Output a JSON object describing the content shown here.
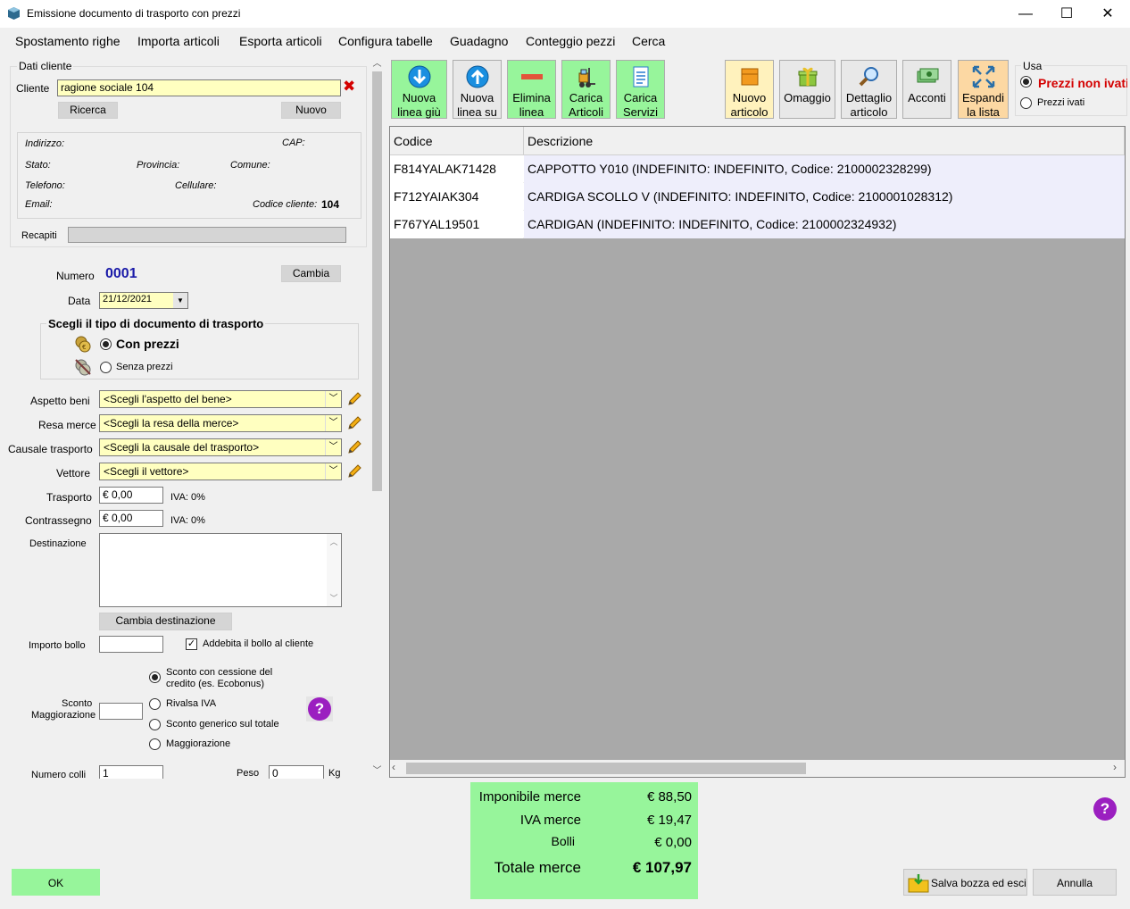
{
  "window": {
    "title": "Emissione documento di trasporto con prezzi",
    "minimize": "—",
    "maximize": "☐",
    "close": "✕"
  },
  "menu": [
    "Spostamento righe",
    "Importa articoli",
    "Esporta articoli",
    "Configura tabelle",
    "Guadagno",
    "Conteggio pezzi",
    "Cerca"
  ],
  "cliente": {
    "group_title": "Dati cliente",
    "label": "Cliente",
    "value": "ragione sociale 104",
    "ricerca": "Ricerca",
    "nuovo": "Nuovo",
    "indirizzo": "Indirizzo:",
    "cap": "CAP:",
    "stato": "Stato:",
    "provincia": "Provincia:",
    "comune": "Comune:",
    "telefono": "Telefono:",
    "cellulare": "Cellulare:",
    "email": "Email:",
    "codice_label": "Codice cliente:",
    "codice_value": "104",
    "recapiti": "Recapiti"
  },
  "documento": {
    "numero_label": "Numero",
    "numero_value": "0001",
    "cambia": "Cambia",
    "data_label": "Data",
    "data_value": "21/12/2021",
    "tipo_title": "Scegli il tipo di documento di trasporto",
    "con_prezzi": "Con prezzi",
    "senza_prezzi": "Senza prezzi"
  },
  "trasporto": {
    "aspetto_label": "Aspetto beni",
    "aspetto_value": "<Scegli l'aspetto del bene>",
    "resa_label": "Resa merce",
    "resa_value": "<Scegli la resa della merce>",
    "causale_label": "Causale trasporto",
    "causale_value": "<Scegli la causale del trasporto>",
    "vettore_label": "Vettore",
    "vettore_value": "<Scegli il vettore>",
    "trasporto_label": "Trasporto",
    "trasporto_value": "€ 0,00",
    "trasporto_iva": "IVA: 0%",
    "contrassegno_label": "Contrassegno",
    "contrassegno_value": "€ 0,00",
    "contrassegno_iva": "IVA: 0%",
    "destinazione_label": "Destinazione",
    "cambia_destinazione": "Cambia destinazione",
    "bollo_label": "Importo bollo",
    "addebita_bollo": "Addebita il bollo al cliente",
    "sconto_label1": "Sconto",
    "sconto_label2": "Maggiorazione",
    "sconto_opt1a": "Sconto con cessione del",
    "sconto_opt1b": "credito (es. Ecobonus)",
    "sconto_opt2": "Rivalsa IVA",
    "sconto_opt3": "Sconto generico sul totale",
    "sconto_opt4": "Maggiorazione",
    "colli_label": "Numero colli",
    "colli_value": "1",
    "peso_label": "Peso",
    "peso_value": "0",
    "peso_unit": "Kg"
  },
  "toolbar": {
    "nuova_giu": [
      "Nuova",
      "linea giù"
    ],
    "nuova_su": [
      "Nuova",
      "linea su"
    ],
    "elimina": [
      "Elimina",
      "linea"
    ],
    "carica_articoli": [
      "Carica",
      "Articoli"
    ],
    "carica_servizi": [
      "Carica",
      "Servizi"
    ],
    "nuovo_articolo": [
      "Nuovo",
      "articolo"
    ],
    "omaggio": "Omaggio",
    "dettaglio": [
      "Dettaglio",
      "articolo"
    ],
    "acconti": "Acconti",
    "espandi": [
      "Espandi",
      "la lista"
    ]
  },
  "usa": {
    "title": "Usa",
    "opt1": "Prezzi non ivati",
    "opt2": "Prezzi ivati"
  },
  "grid": {
    "headers": [
      "Codice",
      "Descrizione"
    ],
    "rows": [
      [
        "F814YALAK71428",
        "CAPPOTTO Y010 (INDEFINITO: INDEFINITO,  Codice: 2100002328299)"
      ],
      [
        "F712YAIAK304",
        "CARDIGA SCOLLO V (INDEFINITO: INDEFINITO,  Codice: 2100001028312)"
      ],
      [
        "F767YAL19501",
        "CARDIGAN (INDEFINITO: INDEFINITO,  Codice: 2100002324932)"
      ]
    ]
  },
  "totali": {
    "imponibile_label": "Imponibile merce",
    "imponibile_value": "€ 88,50",
    "iva_label": "IVA merce",
    "iva_value": "€ 19,47",
    "bolli_label": "Bolli",
    "bolli_value": "€ 0,00",
    "totale_label": "Totale merce",
    "totale_value": "€ 107,97"
  },
  "bottom": {
    "ok": "OK",
    "salva": "Salva bozza ed esci",
    "annulla": "Annulla",
    "help": "?"
  },
  "colors": {
    "green": "#97f59b",
    "yellow_field": "#ffffc0",
    "red": "#d40000",
    "blue_num": "#1a1aa8"
  }
}
